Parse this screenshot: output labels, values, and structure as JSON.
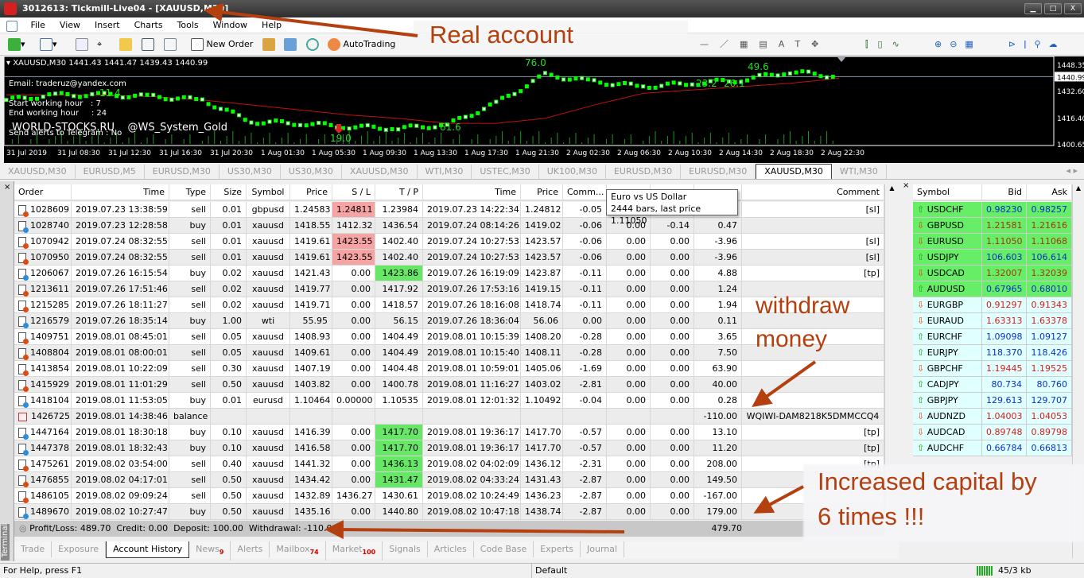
{
  "window": {
    "title": "3012613: Tickmill-Live04 - [XAUUSD,M30]"
  },
  "menu": [
    "File",
    "View",
    "Insert",
    "Charts",
    "Tools",
    "Window",
    "Help"
  ],
  "toolbar": {
    "new_order": "New Order",
    "autotrading": "AutoTrading"
  },
  "chart": {
    "header": "XAUUSD,M30  1441.43 1441.47 1439.43 1440.99",
    "email": "Email: traderuz@yandex.com",
    "start_hour": "Start working hour   : 7",
    "end_hour": "End working hour     : 24",
    "telegram": "Send alerts to Telegram : No",
    "watermark": "WORLD-STOCKS.RU    @WS_System_Gold",
    "signal_labels": [
      "11.4",
      "19.0",
      "61.6",
      "76.0",
      "23.2",
      "26.1",
      "49.6"
    ],
    "price_ticks": [
      "1448.35",
      "1432.60",
      "1416.40",
      "1400.65"
    ],
    "current_price": "1440.99",
    "time_ticks": [
      "31 Jul 2019",
      "31 Jul 08:30",
      "31 Jul 12:30",
      "31 Jul 16:30",
      "31 Jul 20:30",
      "1 Aug 01:30",
      "1 Aug 05:30",
      "1 Aug 09:30",
      "1 Aug 13:30",
      "1 Aug 17:30",
      "1 Aug 21:30",
      "2 Aug 02:30",
      "2 Aug 06:30",
      "2 Aug 10:30",
      "2 Aug 14:30",
      "2 Aug 18:30",
      "2 Aug 22:30"
    ],
    "price_range": [
      1400.65,
      1448.35
    ],
    "close_series": [
      1427,
      1430,
      1430,
      1429,
      1427,
      1414,
      1413,
      1411,
      1410,
      1412,
      1425,
      1442,
      1438,
      1435,
      1437,
      1439,
      1444,
      1441
    ],
    "ma_series": [
      1430,
      1430,
      1430,
      1429,
      1427,
      1424,
      1421,
      1418,
      1416,
      1413,
      1413,
      1416,
      1424,
      1431,
      1433,
      1435,
      1437,
      1440
    ],
    "candle_color": "#00ff00",
    "ma_color": "#c01010"
  },
  "chart_tabs": [
    "XAUUSD,M30",
    "EURUSD,M5",
    "EURUSD,M30",
    "US30,M30",
    "US30,M30",
    "XAUUSD,M30",
    "WTI,M30",
    "USTEC,M30",
    "UK100,M30",
    "EURUSD,M30",
    "EURUSD,M30",
    "XAUUSD,M30",
    "WTI,M30"
  ],
  "history": {
    "columns": [
      "Order",
      "Time",
      "Type",
      "Size",
      "Symbol",
      "Price",
      "S / L",
      "T / P",
      "Time",
      "Price",
      "Comm...",
      "",
      "",
      "",
      "Comment"
    ],
    "rows": [
      {
        "order": "1028609",
        "open": "2019.07.23 13:38:59",
        "type": "sell",
        "size": "0.01",
        "symbol": "gbpusd",
        "price": "1.24583",
        "sl": "1.24811",
        "tp": "1.23984",
        "close": "2019.07.23 14:22:34",
        "cprice": "1.24812",
        "comm": "-0.05",
        "taxes": "",
        "swap": "",
        "profit": "",
        "comment": "[sl]",
        "sl_hl": true
      },
      {
        "order": "1028740",
        "open": "2019.07.23 12:28:58",
        "type": "buy",
        "size": "0.01",
        "symbol": "xauusd",
        "price": "1418.55",
        "sl": "1412.32",
        "tp": "1436.54",
        "close": "2019.07.24 08:14:26",
        "cprice": "1419.02",
        "comm": "-0.06",
        "taxes": "0.00",
        "swap": "-0.14",
        "profit": "0.47",
        "comment": ""
      },
      {
        "order": "1070942",
        "open": "2019.07.24 08:32:55",
        "type": "sell",
        "size": "0.01",
        "symbol": "xauusd",
        "price": "1419.61",
        "sl": "1423.55",
        "tp": "1402.40",
        "close": "2019.07.24 10:27:53",
        "cprice": "1423.57",
        "comm": "-0.06",
        "taxes": "0.00",
        "swap": "0.00",
        "profit": "-3.96",
        "comment": "[sl]",
        "sl_hl": true
      },
      {
        "order": "1070950",
        "open": "2019.07.24 08:32:55",
        "type": "sell",
        "size": "0.01",
        "symbol": "xauusd",
        "price": "1419.61",
        "sl": "1423.55",
        "tp": "1402.40",
        "close": "2019.07.24 10:27:53",
        "cprice": "1423.57",
        "comm": "-0.06",
        "taxes": "0.00",
        "swap": "0.00",
        "profit": "-3.96",
        "comment": "[sl]",
        "sl_hl": true
      },
      {
        "order": "1206067",
        "open": "2019.07.26 16:15:54",
        "type": "buy",
        "size": "0.02",
        "symbol": "xauusd",
        "price": "1421.43",
        "sl": "0.00",
        "tp": "1423.86",
        "close": "2019.07.26 16:19:09",
        "cprice": "1423.87",
        "comm": "-0.11",
        "taxes": "0.00",
        "swap": "0.00",
        "profit": "4.88",
        "comment": "[tp]",
        "tp_hl": true
      },
      {
        "order": "1213611",
        "open": "2019.07.26 17:51:46",
        "type": "sell",
        "size": "0.02",
        "symbol": "xauusd",
        "price": "1419.77",
        "sl": "0.00",
        "tp": "1417.92",
        "close": "2019.07.26 17:53:16",
        "cprice": "1419.15",
        "comm": "-0.11",
        "taxes": "0.00",
        "swap": "0.00",
        "profit": "1.24",
        "comment": ""
      },
      {
        "order": "1215285",
        "open": "2019.07.26 18:11:27",
        "type": "sell",
        "size": "0.02",
        "symbol": "xauusd",
        "price": "1419.71",
        "sl": "0.00",
        "tp": "1418.57",
        "close": "2019.07.26 18:16:08",
        "cprice": "1418.74",
        "comm": "-0.11",
        "taxes": "0.00",
        "swap": "0.00",
        "profit": "1.94",
        "comment": ""
      },
      {
        "order": "1216579",
        "open": "2019.07.26 18:35:14",
        "type": "buy",
        "size": "1.00",
        "symbol": "wti",
        "price": "55.95",
        "sl": "0.00",
        "tp": "56.15",
        "close": "2019.07.26 18:36:04",
        "cprice": "56.06",
        "comm": "0.00",
        "taxes": "0.00",
        "swap": "0.00",
        "profit": "0.11",
        "comment": ""
      },
      {
        "order": "1409751",
        "open": "2019.08.01 08:45:01",
        "type": "sell",
        "size": "0.05",
        "symbol": "xauusd",
        "price": "1408.93",
        "sl": "0.00",
        "tp": "1404.49",
        "close": "2019.08.01 10:15:39",
        "cprice": "1408.20",
        "comm": "-0.28",
        "taxes": "0.00",
        "swap": "0.00",
        "profit": "3.65",
        "comment": ""
      },
      {
        "order": "1408804",
        "open": "2019.08.01 08:00:01",
        "type": "sell",
        "size": "0.05",
        "symbol": "xauusd",
        "price": "1409.61",
        "sl": "0.00",
        "tp": "1404.49",
        "close": "2019.08.01 10:15:40",
        "cprice": "1408.11",
        "comm": "-0.28",
        "taxes": "0.00",
        "swap": "0.00",
        "profit": "7.50",
        "comment": ""
      },
      {
        "order": "1413854",
        "open": "2019.08.01 10:22:09",
        "type": "sell",
        "size": "0.30",
        "symbol": "xauusd",
        "price": "1407.19",
        "sl": "0.00",
        "tp": "1404.48",
        "close": "2019.08.01 10:59:01",
        "cprice": "1405.06",
        "comm": "-1.69",
        "taxes": "0.00",
        "swap": "0.00",
        "profit": "63.90",
        "comment": ""
      },
      {
        "order": "1415929",
        "open": "2019.08.01 11:01:29",
        "type": "sell",
        "size": "0.50",
        "symbol": "xauusd",
        "price": "1403.82",
        "sl": "0.00",
        "tp": "1400.78",
        "close": "2019.08.01 11:16:27",
        "cprice": "1403.02",
        "comm": "-2.81",
        "taxes": "0.00",
        "swap": "0.00",
        "profit": "40.00",
        "comment": ""
      },
      {
        "order": "1418104",
        "open": "2019.08.01 11:53:05",
        "type": "buy",
        "size": "0.01",
        "symbol": "eurusd",
        "price": "1.10464",
        "sl": "0.00000",
        "tp": "1.10535",
        "close": "2019.08.01 12:01:32",
        "cprice": "1.10492",
        "comm": "-0.04",
        "taxes": "0.00",
        "swap": "0.00",
        "profit": "0.28",
        "comment": ""
      },
      {
        "order": "1426725",
        "open": "2019.08.01 14:38:46",
        "type": "balance",
        "size": "",
        "symbol": "",
        "price": "",
        "sl": "",
        "tp": "",
        "close": "",
        "cprice": "",
        "comm": "",
        "taxes": "",
        "swap": "",
        "profit": "-110.00",
        "comment": "WQIWI-DAM8218K5DMMCCQ4",
        "balance": true
      },
      {
        "order": "1447164",
        "open": "2019.08.01 18:30:18",
        "type": "buy",
        "size": "0.10",
        "symbol": "xauusd",
        "price": "1416.39",
        "sl": "0.00",
        "tp": "1417.70",
        "close": "2019.08.01 19:36:17",
        "cprice": "1417.70",
        "comm": "-0.57",
        "taxes": "0.00",
        "swap": "0.00",
        "profit": "13.10",
        "comment": "[tp]",
        "tp_hl": true
      },
      {
        "order": "1447378",
        "open": "2019.08.01 18:32:43",
        "type": "buy",
        "size": "0.10",
        "symbol": "xauusd",
        "price": "1416.58",
        "sl": "0.00",
        "tp": "1417.70",
        "close": "2019.08.01 19:36:17",
        "cprice": "1417.70",
        "comm": "-0.57",
        "taxes": "0.00",
        "swap": "0.00",
        "profit": "11.20",
        "comment": "[tp]",
        "tp_hl": true
      },
      {
        "order": "1475261",
        "open": "2019.08.02 03:54:00",
        "type": "sell",
        "size": "0.40",
        "symbol": "xauusd",
        "price": "1441.32",
        "sl": "0.00",
        "tp": "1436.13",
        "close": "2019.08.02 04:02:09",
        "cprice": "1436.12",
        "comm": "-2.31",
        "taxes": "0.00",
        "swap": "0.00",
        "profit": "208.00",
        "comment": "[tp]",
        "tp_hl": true
      },
      {
        "order": "1476855",
        "open": "2019.08.02 04:17:01",
        "type": "sell",
        "size": "0.50",
        "symbol": "xauusd",
        "price": "1434.42",
        "sl": "0.00",
        "tp": "1431.47",
        "close": "2019.08.02 04:33:24",
        "cprice": "1431.43",
        "comm": "-2.87",
        "taxes": "0.00",
        "swap": "0.00",
        "profit": "149.50",
        "comment": "",
        "tp_hl": true
      },
      {
        "order": "1486105",
        "open": "2019.08.02 09:09:24",
        "type": "sell",
        "size": "0.50",
        "symbol": "xauusd",
        "price": "1432.89",
        "sl": "1436.27",
        "tp": "1430.61",
        "close": "2019.08.02 10:24:49",
        "cprice": "1436.23",
        "comm": "-2.87",
        "taxes": "0.00",
        "swap": "0.00",
        "profit": "-167.00",
        "comment": ""
      },
      {
        "order": "1489670",
        "open": "2019.08.02 10:27:47",
        "type": "buy",
        "size": "0.50",
        "symbol": "xauusd",
        "price": "1435.16",
        "sl": "0.00",
        "tp": "1440.80",
        "close": "2019.08.02 10:47:18",
        "cprice": "1438.74",
        "comm": "-2.87",
        "taxes": "0.00",
        "swap": "0.00",
        "profit": "179.00",
        "comment": ""
      }
    ],
    "summary": "Profit/Loss: 489.70  Credit: 0.00  Deposit: 100.00  Withdrawal: -110.00",
    "total": "479.70",
    "sl_color": "#f5a3a3",
    "tp_color": "#66e866"
  },
  "tooltip": {
    "line1": "Euro vs US Dollar",
    "line2": "2444 bars, last price 1.11050"
  },
  "terminal_label": "Terminal",
  "bottom_tabs": [
    {
      "label": "Trade"
    },
    {
      "label": "Exposure"
    },
    {
      "label": "Account History",
      "active": true
    },
    {
      "label": "News",
      "badge": "9"
    },
    {
      "label": "Alerts"
    },
    {
      "label": "Mailbox",
      "badge": "74"
    },
    {
      "label": "Market",
      "badge": "100"
    },
    {
      "label": "Signals"
    },
    {
      "label": "Articles"
    },
    {
      "label": "Code Base"
    },
    {
      "label": "Experts"
    },
    {
      "label": "Journal"
    }
  ],
  "market_watch": {
    "columns": [
      "Symbol",
      "Bid",
      "Ask"
    ],
    "rows": [
      {
        "symbol": "USDCHF",
        "bid": "0.98230",
        "ask": "0.98257",
        "dir": "up",
        "hl": true
      },
      {
        "symbol": "GBPUSD",
        "bid": "1.21581",
        "ask": "1.21616",
        "dir": "down",
        "hl": true
      },
      {
        "symbol": "EURUSD",
        "bid": "1.11050",
        "ask": "1.11068",
        "dir": "down",
        "hl": true
      },
      {
        "symbol": "USDJPY",
        "bid": "106.603",
        "ask": "106.614",
        "dir": "up",
        "hl": true
      },
      {
        "symbol": "USDCAD",
        "bid": "1.32007",
        "ask": "1.32039",
        "dir": "down",
        "hl": true
      },
      {
        "symbol": "AUDUSD",
        "bid": "0.67965",
        "ask": "0.68010",
        "dir": "up",
        "hl": true
      },
      {
        "symbol": "EURGBP",
        "bid": "0.91297",
        "ask": "0.91343",
        "dir": "down"
      },
      {
        "symbol": "EURAUD",
        "bid": "1.63313",
        "ask": "1.63378",
        "dir": "down"
      },
      {
        "symbol": "EURCHF",
        "bid": "1.09098",
        "ask": "1.09127",
        "dir": "up"
      },
      {
        "symbol": "EURJPY",
        "bid": "118.370",
        "ask": "118.426",
        "dir": "up"
      },
      {
        "symbol": "GBPCHF",
        "bid": "1.19445",
        "ask": "1.19525",
        "dir": "down"
      },
      {
        "symbol": "CADJPY",
        "bid": "80.734",
        "ask": "80.760",
        "dir": "up"
      },
      {
        "symbol": "GBPJPY",
        "bid": "129.613",
        "ask": "129.707",
        "dir": "up"
      },
      {
        "symbol": "AUDNZD",
        "bid": "1.04003",
        "ask": "1.04053",
        "dir": "down"
      },
      {
        "symbol": "AUDCAD",
        "bid": "0.89748",
        "ask": "0.89798",
        "dir": "down"
      },
      {
        "symbol": "AUDCHF",
        "bid": "0.66784",
        "ask": "0.66813",
        "dir": "up"
      }
    ],
    "up_bg": "#66ee66",
    "normal_bg": "#e0ffff",
    "up_text": "#0a2fd0",
    "down_text": "#e01818"
  },
  "status": {
    "help": "For Help, press F1",
    "profile": "Default",
    "traffic": "45/3 kb"
  },
  "annotations": {
    "real": "Real account",
    "withdraw1": "withdraw",
    "withdraw2": "money",
    "inc1": "Increased capital by",
    "inc2": "6 times !!!",
    "color": "#b5400f"
  }
}
